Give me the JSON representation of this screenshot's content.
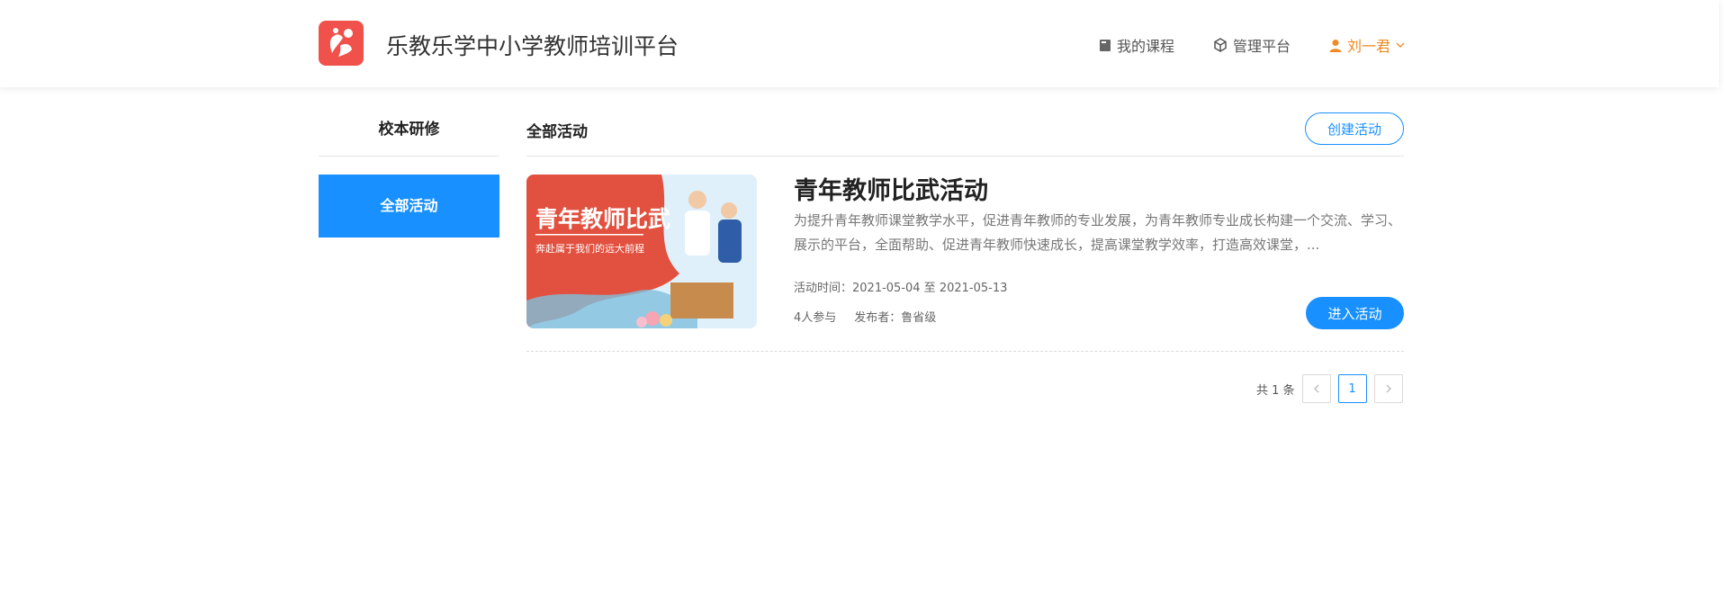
{
  "header": {
    "site_title": "乐教乐学中小学教师培训平台",
    "nav": {
      "my_courses": "我的课程",
      "admin": "管理平台",
      "user": "刘一君"
    }
  },
  "sidebar": {
    "title": "校本研修",
    "items": [
      {
        "label": "全部活动",
        "active": true
      }
    ]
  },
  "main": {
    "tab": "全部活动",
    "create_button": "创建活动",
    "activities": [
      {
        "image_title": "青年教师比武",
        "image_subtitle": "奔赴属于我们的远大前程",
        "title": "青年教师比武活动",
        "description": "为提升青年教师课堂教学水平，促进青年教师的专业发展，为青年教师专业成长构建一个交流、学习、展示的平台，全面帮助、促进青年教师快速成长，提高课堂教学效率，打造高效课堂，...",
        "time": "活动时间：2021-05-04 至 2021-05-13",
        "participants": "4人参与",
        "publisher": "发布者：鲁省级",
        "enter_button": "进入活动"
      }
    ],
    "pagination": {
      "total": "共 1 条",
      "current": "1"
    }
  },
  "colors": {
    "primary": "#1890ff",
    "user_accent": "#f08a24",
    "logo_bg": "#f0524b"
  }
}
